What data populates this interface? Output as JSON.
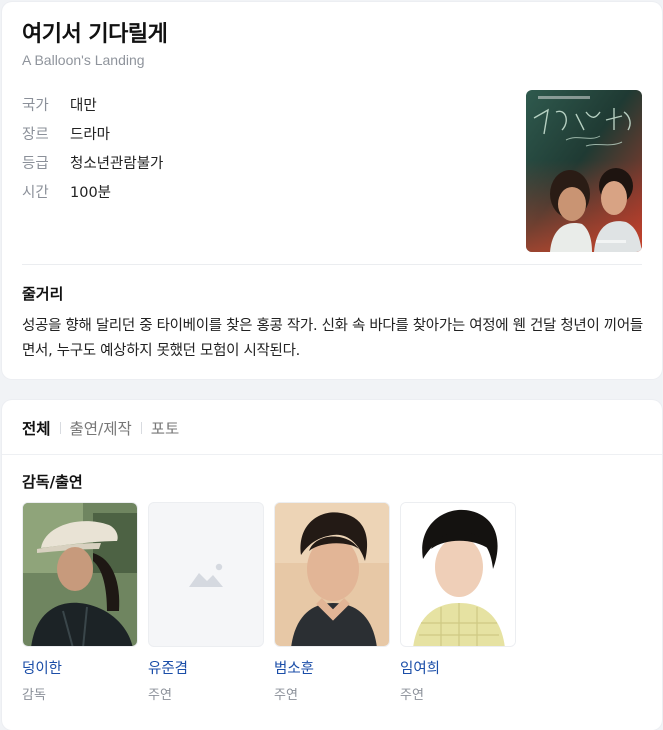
{
  "movie": {
    "title": "여기서 기다릴게",
    "original_title": "A Balloon's Landing",
    "info": [
      {
        "label": "국가",
        "value": "대만"
      },
      {
        "label": "장르",
        "value": "드라마"
      },
      {
        "label": "등급",
        "value": "청소년관람불가"
      },
      {
        "label": "시간",
        "value": "100분"
      }
    ],
    "synopsis_heading": "줄거리",
    "synopsis": "성공을 향해 달리던 중 타이베이를 찾은 홍콩 작가. 신화 속 바다를 찾아가는 여정에 웬 건달 청년이 끼어들면서, 누구도 예상하지 못했던 모험이 시작된다."
  },
  "tabs": [
    "전체",
    "출연/제작",
    "포토"
  ],
  "cast_heading": "감독/출연",
  "cast": [
    {
      "name": "덩이한",
      "role": "감독",
      "photo": "photo"
    },
    {
      "name": "유준겸",
      "role": "주연",
      "photo": "placeholder-image-icon"
    },
    {
      "name": "범소훈",
      "role": "주연",
      "photo": "photo"
    },
    {
      "name": "임여희",
      "role": "주연",
      "photo": "photo"
    }
  ],
  "colors": {
    "link": "#1b4ea8",
    "muted": "#8b9099",
    "background": "#f1f3f6"
  }
}
